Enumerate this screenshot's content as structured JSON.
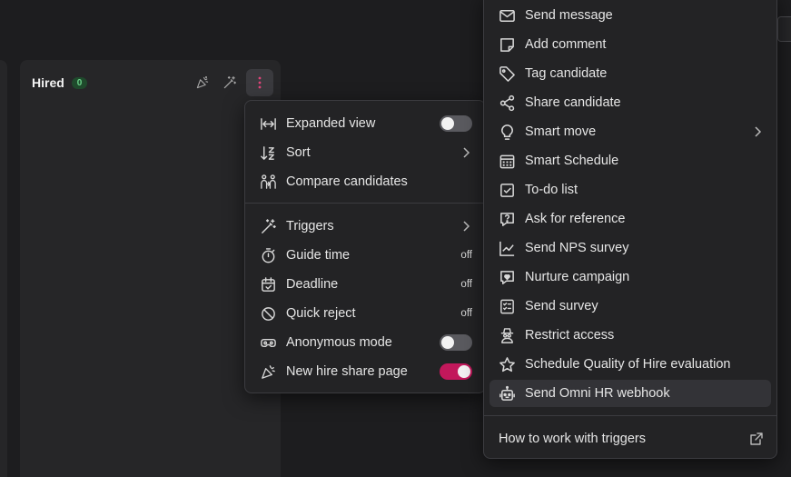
{
  "column": {
    "title": "Hired",
    "count": "0"
  },
  "column_menu": {
    "items": [
      {
        "label": "Expanded view",
        "icon": "expand-horizontal-icon",
        "control": "toggle",
        "on": false
      },
      {
        "label": "Sort",
        "icon": "sort-icon",
        "control": "submenu"
      },
      {
        "label": "Compare candidates",
        "icon": "compare-people-icon",
        "control": "none"
      },
      {
        "label": "Triggers",
        "icon": "magic-wand-icon",
        "control": "submenu"
      },
      {
        "label": "Guide time",
        "icon": "stopwatch-icon",
        "control": "status",
        "status": "off"
      },
      {
        "label": "Deadline",
        "icon": "calendar-check-icon",
        "control": "status",
        "status": "off"
      },
      {
        "label": "Quick reject",
        "icon": "prohibited-icon",
        "control": "status",
        "status": "off"
      },
      {
        "label": "Anonymous mode",
        "icon": "incognito-mask-icon",
        "control": "toggle",
        "on": false
      },
      {
        "label": "New hire share page",
        "icon": "party-popper-icon",
        "control": "toggle",
        "on": true
      }
    ]
  },
  "trigger_menu": {
    "items": [
      {
        "label": "Send message",
        "icon": "envelope-icon"
      },
      {
        "label": "Add comment",
        "icon": "sticky-note-icon"
      },
      {
        "label": "Tag candidate",
        "icon": "tag-icon"
      },
      {
        "label": "Share candidate",
        "icon": "share-icon"
      },
      {
        "label": "Smart move",
        "icon": "lightbulb-icon",
        "submenu": true
      },
      {
        "label": "Smart Schedule",
        "icon": "calendar-grid-icon"
      },
      {
        "label": "To-do list",
        "icon": "checkbox-icon"
      },
      {
        "label": "Ask for reference",
        "icon": "question-bubble-icon"
      },
      {
        "label": "Send NPS survey",
        "icon": "line-chart-icon"
      },
      {
        "label": "Nurture campaign",
        "icon": "heart-bubble-icon"
      },
      {
        "label": "Send survey",
        "icon": "checklist-icon"
      },
      {
        "label": "Restrict access",
        "icon": "spy-icon"
      },
      {
        "label": "Schedule Quality of Hire evaluation",
        "icon": "star-icon"
      },
      {
        "label": "Send Omni HR webhook",
        "icon": "robot-icon",
        "active": true
      }
    ],
    "footer_link": "How to work with triggers"
  },
  "colors": {
    "background": "#1d1d1f",
    "panel": "#262628",
    "menu": "#232325",
    "accent_toggle": "#c2185b",
    "count_badge": "#1f4a2c",
    "kebab_dots": "#e0447a"
  }
}
